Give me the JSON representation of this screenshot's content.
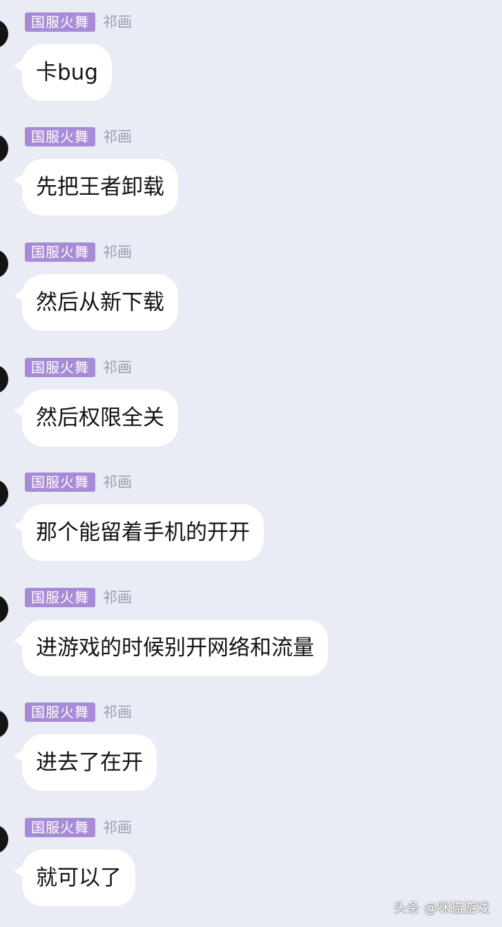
{
  "messages": [
    {
      "tag": "国服火舞",
      "sender": "祁画",
      "text": "卡bug"
    },
    {
      "tag": "国服火舞",
      "sender": "祁画",
      "text": "先把王者卸载"
    },
    {
      "tag": "国服火舞",
      "sender": "祁画",
      "text": "然后从新下载"
    },
    {
      "tag": "国服火舞",
      "sender": "祁画",
      "text": "然后权限全关"
    },
    {
      "tag": "国服火舞",
      "sender": "祁画",
      "text": "那个能留着手机的开开"
    },
    {
      "tag": "国服火舞",
      "sender": "祁画",
      "text": "进游戏的时候别开网络和流量"
    },
    {
      "tag": "国服火舞",
      "sender": "祁画",
      "text": "进去了在开"
    },
    {
      "tag": "国服火舞",
      "sender": "祁画",
      "text": "就可以了"
    }
  ],
  "watermark": "头条 @咪猫游戏",
  "colors": {
    "background": "#e9ebf5",
    "tag_background": "#a88bd6",
    "bubble": "#ffffff",
    "sender_text": "#9b9fab"
  }
}
